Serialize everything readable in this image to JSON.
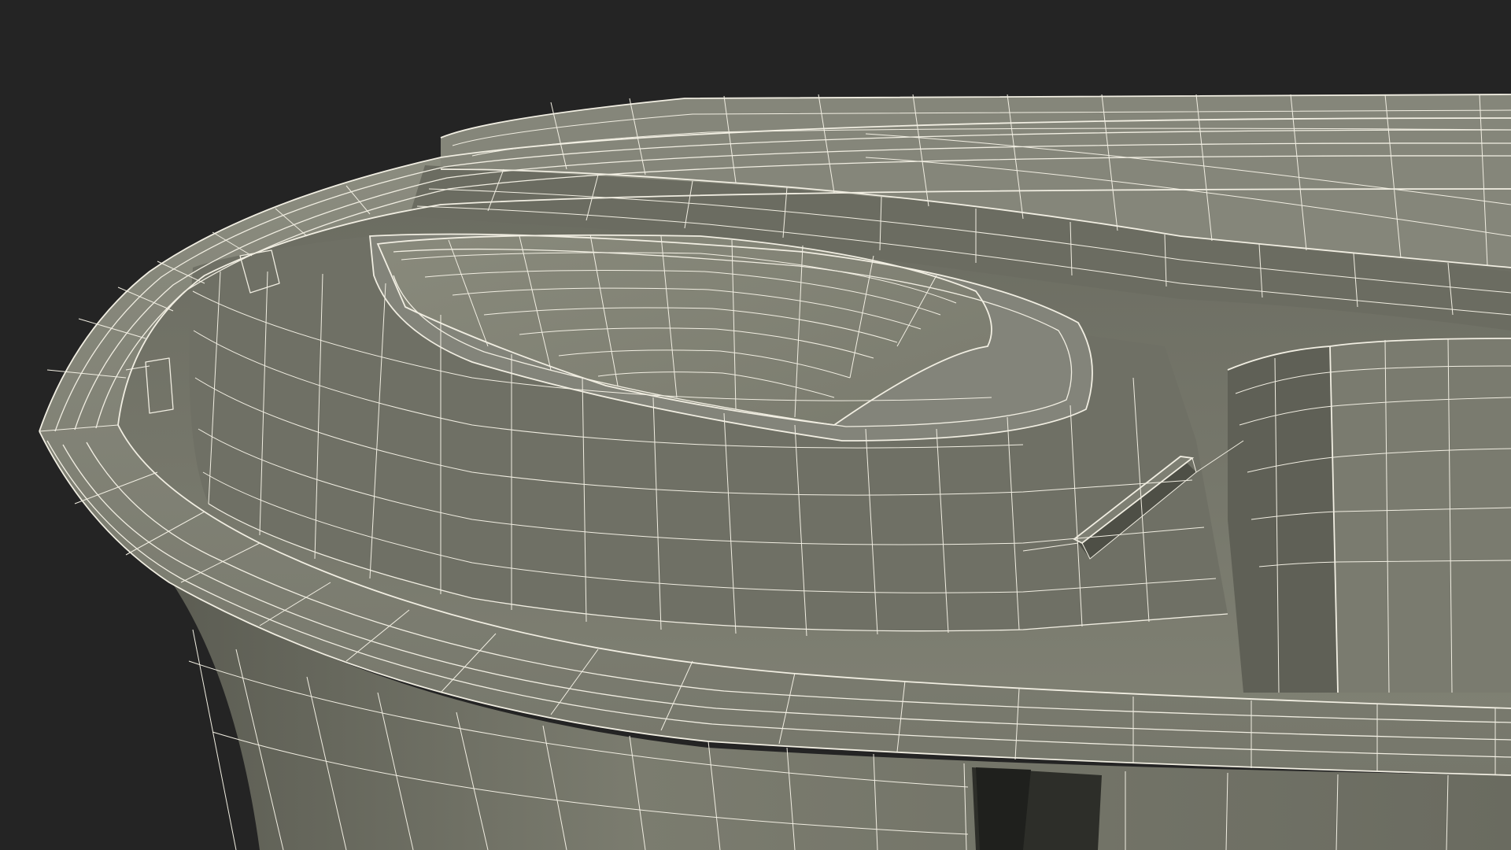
{
  "scene": {
    "subject": "wireframe-render",
    "colors": {
      "background": "#242424",
      "surface_light": "#8a8b7d",
      "surface_mid": "#75766a",
      "surface_dark": "#55564d",
      "shadow": "#34352f",
      "wire": "#f1eee2"
    }
  }
}
